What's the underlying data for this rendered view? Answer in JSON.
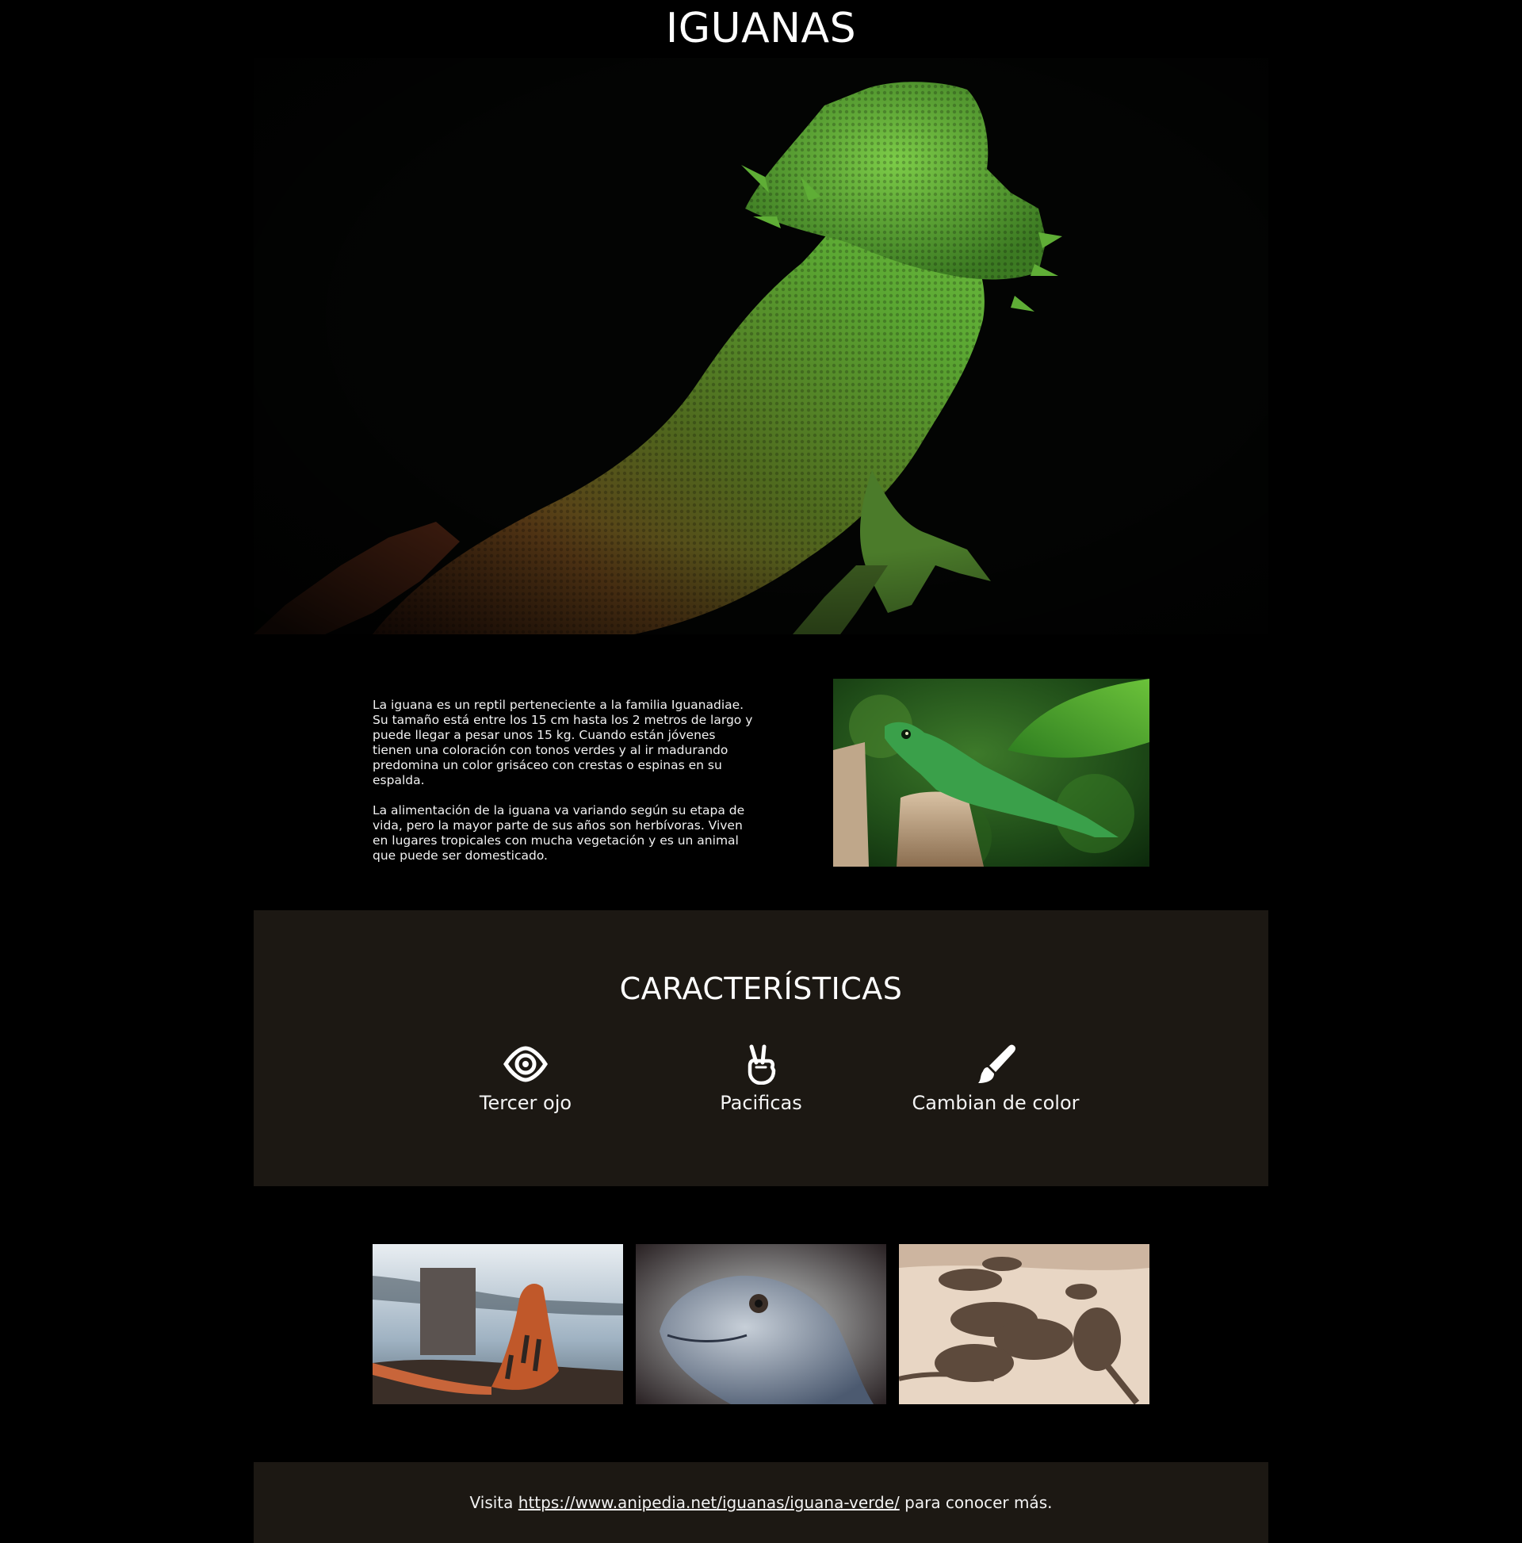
{
  "page": {
    "title": "IGUANAS"
  },
  "intro": {
    "paragraph_1": "La iguana es un reptil perteneciente a la familia Iguanadiae. Su tamaño está entre los 15 cm hasta los 2 metros de largo y puede llegar a pesar unos 15 kg. Cuando están jóvenes tienen una coloración con tonos verdes y al ir madurando predomina un color grisáceo con crestas o espinas en su espalda.",
    "paragraph_2": "La alimentación de la iguana va variando según su etapa de vida, pero la mayor parte de sus años son herbívoras. Viven en lugares tropicales con mucha vegetación y es un animal que puede ser domesticado."
  },
  "features": {
    "heading": "CARACTERÍSTICAS",
    "items": [
      {
        "label": "Tercer ojo",
        "icon": "eye-icon"
      },
      {
        "label": "Pacificas",
        "icon": "peace-hand-icon"
      },
      {
        "label": "Cambian de color",
        "icon": "paintbrush-icon"
      }
    ]
  },
  "footer": {
    "prefix": "Visita",
    "link_text": "https://www.anipedia.net/iguanas/iguana-verde/",
    "suffix": "para conocer más."
  },
  "colors": {
    "page_background": "#000000",
    "panel_background": "#1c1813",
    "text": "#ffffff"
  }
}
